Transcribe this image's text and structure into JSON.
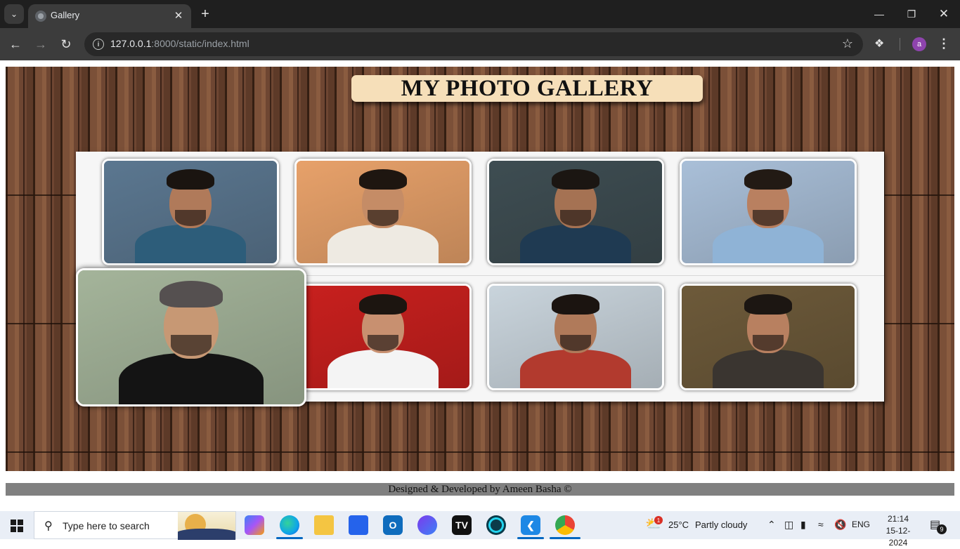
{
  "browser": {
    "tab_title": "Gallery",
    "url_host": "127.0.0.1",
    "url_rest": ":8000/static/index.html",
    "profile_initial": "a"
  },
  "page": {
    "heading": "MY PHOTO GALLERY",
    "footer": "Designed & Developed by Ameen Basha ©",
    "photos": [
      {
        "bg": "#5b7790",
        "skin": "#b07a5a",
        "hair": "#1a1410",
        "shirt": "#2d5d7a"
      },
      {
        "bg": "#e7a16a",
        "skin": "#c58c66",
        "hair": "#1e1610",
        "shirt": "#eeeae2"
      },
      {
        "bg": "#3e4d52",
        "skin": "#a57253",
        "hair": "#1b1612",
        "shirt": "#1f3a52"
      },
      {
        "bg": "#a9bfd8",
        "skin": "#b98060",
        "hair": "#221a14",
        "shirt": "#8fb3d6"
      },
      {
        "bg": "#a4b49a",
        "skin": "#c79874",
        "hair": "#555050",
        "shirt": "#141414"
      },
      {
        "bg": "#c8201e",
        "skin": "#c89070",
        "hair": "#1c1510",
        "shirt": "#f4f4f4"
      },
      {
        "bg": "#c9d4dc",
        "skin": "#b07a5a",
        "hair": "#1b1410",
        "shirt": "#b23a2e"
      },
      {
        "bg": "#6d5a3a",
        "skin": "#b88060",
        "hair": "#1c1612",
        "shirt": "#3a3530"
      }
    ]
  },
  "taskbar": {
    "search_placeholder": "Type here to search",
    "weather_temp": "25°C",
    "weather_text": "Partly cloudy",
    "weather_badge": "1",
    "language": "ENG",
    "time": "21:14",
    "date": "15-12-2024",
    "notification_count": "9"
  }
}
